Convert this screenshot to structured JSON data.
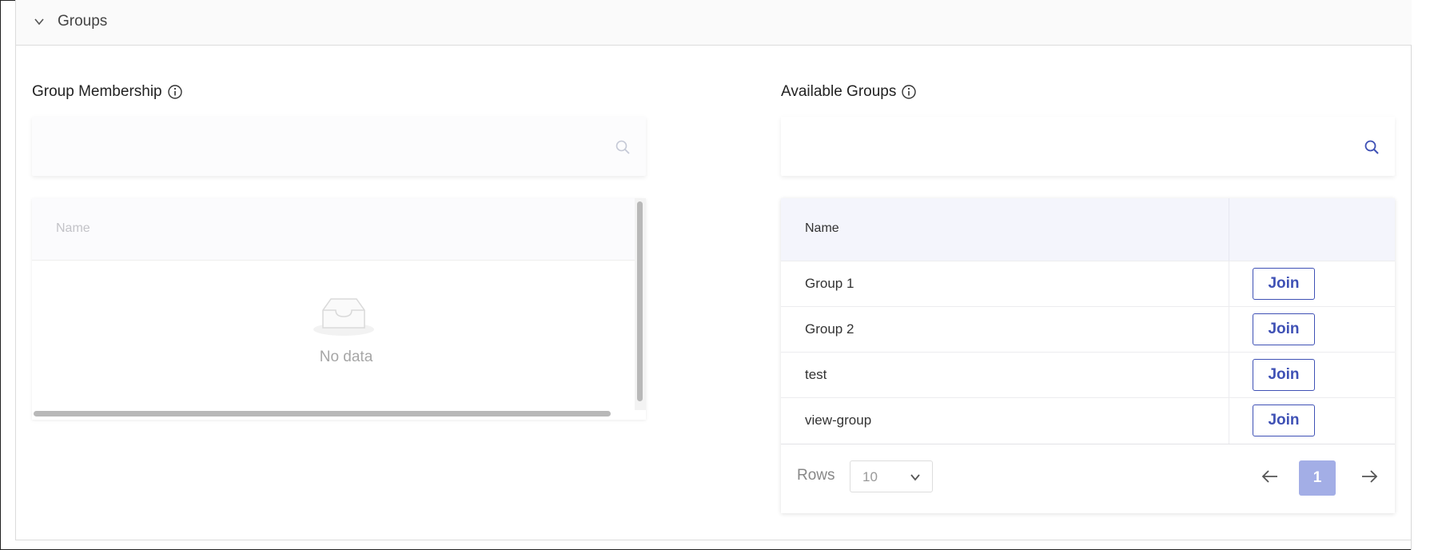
{
  "panel": {
    "title": "Groups",
    "toggle_icon": "chevron-down-icon"
  },
  "membership": {
    "title": "Group Membership",
    "info_icon": "info-icon",
    "search": {
      "value": "",
      "placeholder": "",
      "icon": "search-icon"
    },
    "table": {
      "columns": [
        "Name"
      ],
      "rows": [],
      "empty_text": "No data",
      "empty_icon": "inbox-icon"
    }
  },
  "available": {
    "title": "Available Groups",
    "info_icon": "info-icon",
    "search": {
      "value": "",
      "placeholder": "",
      "icon": "search-icon"
    },
    "table": {
      "columns": [
        "Name",
        ""
      ],
      "rows": [
        {
          "name": "Group 1",
          "action": "Join"
        },
        {
          "name": "Group 2",
          "action": "Join"
        },
        {
          "name": "test",
          "action": "Join"
        },
        {
          "name": "view-group",
          "action": "Join"
        }
      ]
    },
    "pagination": {
      "rows_label": "Rows",
      "rows_value": "10",
      "current_page": "1",
      "prev_icon": "arrow-left-icon",
      "next_icon": "arrow-right-icon"
    }
  },
  "colors": {
    "accent": "#3f51b5",
    "active_page": "#a3aee6",
    "header_bg": "#f4f5fc"
  }
}
